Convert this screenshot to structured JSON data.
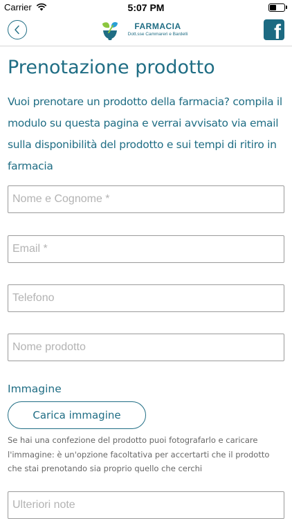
{
  "status_bar": {
    "carrier": "Carrier",
    "time": "5:07 PM",
    "battery_level": 0.4
  },
  "nav": {
    "back_icon": "chevron-left-icon",
    "logo_title": "FARMACIA",
    "logo_subtitle": "Dott.sse Cammareri e Bardelli",
    "facebook_icon": "facebook-icon",
    "facebook_letter": "f"
  },
  "page": {
    "title": "Prenotazione prodotto",
    "intro": "Vuoi prenotare un prodotto della farmacia? compila il modulo su questa pagina e verrai avvisato via email sulla disponibilità del prodotto e sui tempi di ritiro in farmacia"
  },
  "form": {
    "name_placeholder": "Nome e Cognome *",
    "email_placeholder": "Email *",
    "phone_placeholder": "Telefono",
    "product_placeholder": "Nome prodotto",
    "image_label": "Immagine",
    "upload_label": "Carica immagine",
    "image_help": "Se hai una confezione del prodotto puoi fotografarlo e caricare l'immagine: è un'opzione facoltativa per accertarti che il prodotto che stai prenotando sia proprio quello che cerchi",
    "notes_placeholder": "Ulteriori note"
  },
  "colors": {
    "brand": "#1f6d84",
    "logo_green": "#8cc63f",
    "logo_blue": "#2a9fd6"
  }
}
